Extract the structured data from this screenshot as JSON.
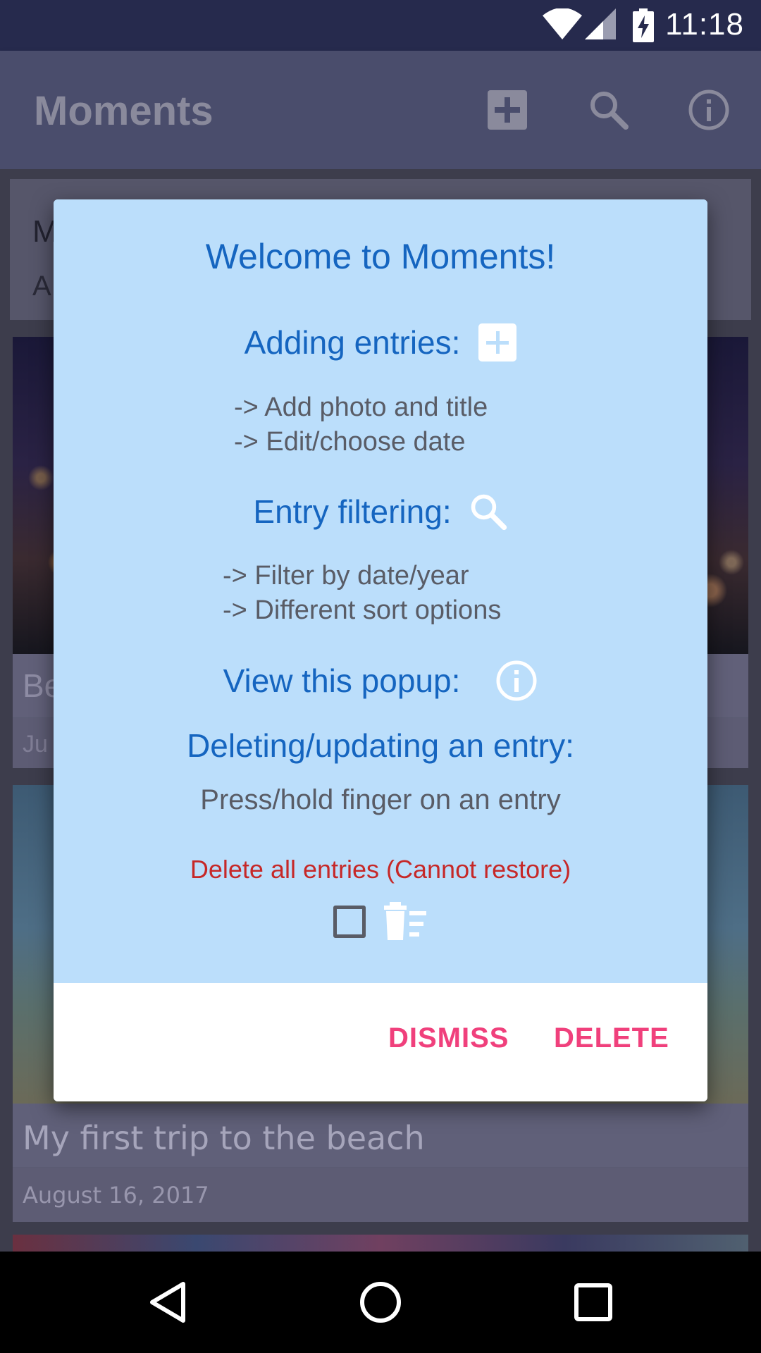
{
  "status_bar": {
    "time": "11:18"
  },
  "app_bar": {
    "title": "Moments"
  },
  "background_cards": {
    "card1": {
      "title_partial": "M",
      "subtitle_partial": "A"
    },
    "card2": {
      "title_partial": "Be",
      "date_partial": "Ju"
    },
    "card3": {
      "title": "My first trip to the beach",
      "date": "August 16, 2017"
    }
  },
  "dialog": {
    "title": "Welcome to Moments!",
    "adding": {
      "heading": "Adding entries:",
      "line1": "-> Add photo and title",
      "line2": "-> Edit/choose date"
    },
    "filtering": {
      "heading": "Entry filtering:",
      "line1": "-> Filter by date/year",
      "line2": "-> Different sort options"
    },
    "popup": {
      "heading": "View this popup:"
    },
    "deleting": {
      "heading": "Deleting/updating an entry:",
      "text": "Press/hold finger on an entry"
    },
    "delete_all": {
      "warning": "Delete all entries (Cannot restore)",
      "checked": false
    },
    "actions": {
      "dismiss": "DISMISS",
      "delete": "DELETE"
    }
  },
  "colors": {
    "accent": "#f0407c",
    "dialog_bg": "#bbdefb",
    "heading_blue": "#1565c0",
    "warning_red": "#c62828",
    "status_bar": "#262a4d"
  }
}
